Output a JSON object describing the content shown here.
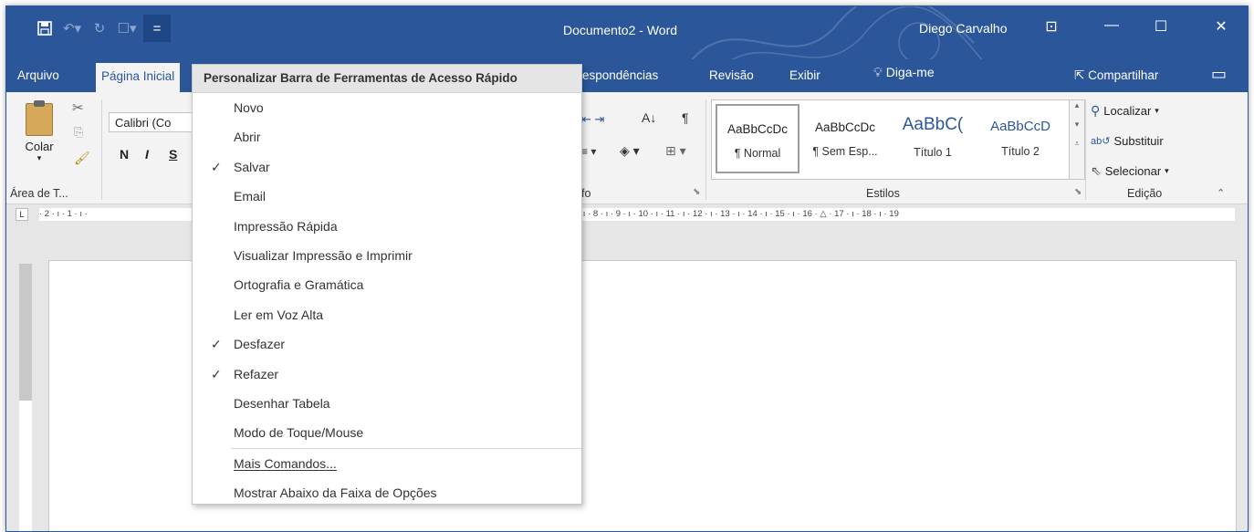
{
  "window": {
    "title": "Documento2 - Word",
    "user": "Diego Carvalho",
    "accent": "#2b579a"
  },
  "qat": {
    "save_icon": "save-icon",
    "undo_icon": "undo-icon",
    "redo_icon": "redo-icon",
    "touch_icon": "touch-mode-icon",
    "customize_label": "="
  },
  "tabs": {
    "file": "Arquivo",
    "home": "Página Inicial",
    "mailings_partial": "rrespondências",
    "review": "Revisão",
    "view": "Exibir",
    "tellme": "Diga-me",
    "share": "Compartilhar"
  },
  "ribbon": {
    "paste_label": "Colar",
    "clipboard_group": "Área de T...",
    "font_name": "Calibri (Co",
    "bold": "N",
    "italic": "I",
    "underline": "S",
    "paragraph_group_partial": "fo",
    "styles_group": "Estilos",
    "editing_group": "Edição",
    "styles": [
      {
        "preview": "AaBbCcDc",
        "name": "¶ Normal"
      },
      {
        "preview": "AaBbCcDc",
        "name": "¶ Sem Esp..."
      },
      {
        "preview": "AaBbC(",
        "name": "Título 1"
      },
      {
        "preview": "AaBbCcD",
        "name": "Título 2"
      }
    ],
    "find": "Localizar",
    "replace": "Substituir",
    "select": "Selecionar"
  },
  "ruler": {
    "left_marks": "· 2 · ı · 1 · ı ·",
    "right_marks": "· ı · 8 · ı · 9 · ı · 10 · ı · 11 · ı · 12 · ı · 13 · ı · 14 · ı · 15 · ı · 16 · △ · 17 · ı · 18 · ı · 19"
  },
  "menu": {
    "header": "Personalizar Barra de Ferramentas de Acesso Rápido",
    "items": [
      {
        "label": "Novo",
        "checked": false
      },
      {
        "label": "Abrir",
        "checked": false
      },
      {
        "label": "Salvar",
        "checked": true
      },
      {
        "label": "Email",
        "checked": false
      },
      {
        "label": "Impressão Rápida",
        "checked": false
      },
      {
        "label": "Visualizar Impressão e Imprimir",
        "checked": false
      },
      {
        "label": "Ortografia e Gramática",
        "checked": false
      },
      {
        "label": "Ler em Voz Alta",
        "checked": false
      },
      {
        "label": "Desfazer",
        "checked": true
      },
      {
        "label": "Refazer",
        "checked": true
      },
      {
        "label": "Desenhar Tabela",
        "checked": false
      },
      {
        "label": "Modo de Toque/Mouse",
        "checked": false
      }
    ],
    "more_commands": "Mais Comandos...",
    "show_below": "Mostrar Abaixo da Faixa de Opções",
    "check_glyph": "✓"
  }
}
